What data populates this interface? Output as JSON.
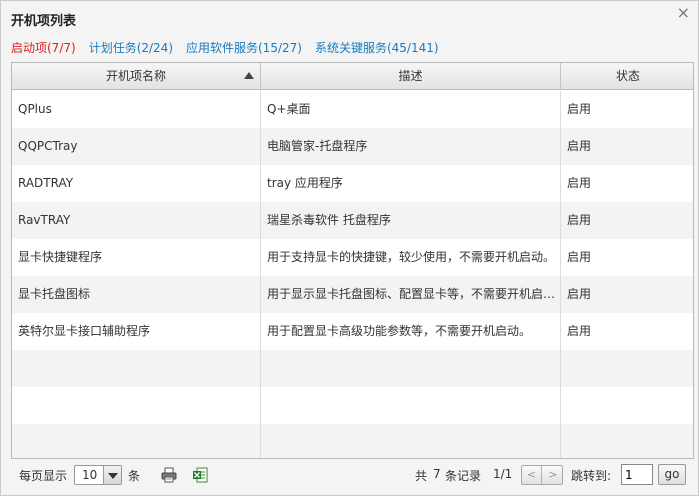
{
  "window": {
    "title": "开机项列表",
    "close_glyph": "×"
  },
  "tabs": [
    {
      "label": "启动项(7/7)",
      "active": true
    },
    {
      "label": "计划任务(2/24)"
    },
    {
      "label": "应用软件服务(15/27)"
    },
    {
      "label": "系统关键服务(45/141)"
    }
  ],
  "table": {
    "columns": [
      "开机项名称",
      "描述",
      "状态"
    ],
    "rows": [
      {
        "name": "QPlus",
        "desc": "Q+桌面",
        "status": "启用"
      },
      {
        "name": "QQPCTray",
        "desc": "电脑管家-托盘程序",
        "status": "启用"
      },
      {
        "name": "RADTRAY",
        "desc": "tray 应用程序",
        "status": "启用"
      },
      {
        "name": "RavTRAY",
        "desc": "瑞星杀毒软件 托盘程序",
        "status": "启用"
      },
      {
        "name": "显卡快捷键程序",
        "desc": "用于支持显卡的快捷键，较少使用，不需要开机启动。",
        "status": "启用"
      },
      {
        "name": "显卡托盘图标",
        "desc": "用于显示显卡托盘图标、配置显卡等，不需要开机启动。",
        "status": "启用"
      },
      {
        "name": "英特尔显卡接口辅助程序",
        "desc": "用于配置显卡高级功能参数等，不需要开机启动。",
        "status": "启用"
      }
    ]
  },
  "footer": {
    "per_page_label": "每页显示",
    "per_page_value": "10",
    "per_page_unit": "条",
    "print_icon": "printer-icon",
    "excel_icon": "excel-export-icon",
    "total_prefix": "共",
    "total_count": "7",
    "total_suffix": "条记录",
    "page_info": "1/1",
    "jump_label": "跳转到:",
    "jump_value": "1",
    "go_label": "go"
  }
}
